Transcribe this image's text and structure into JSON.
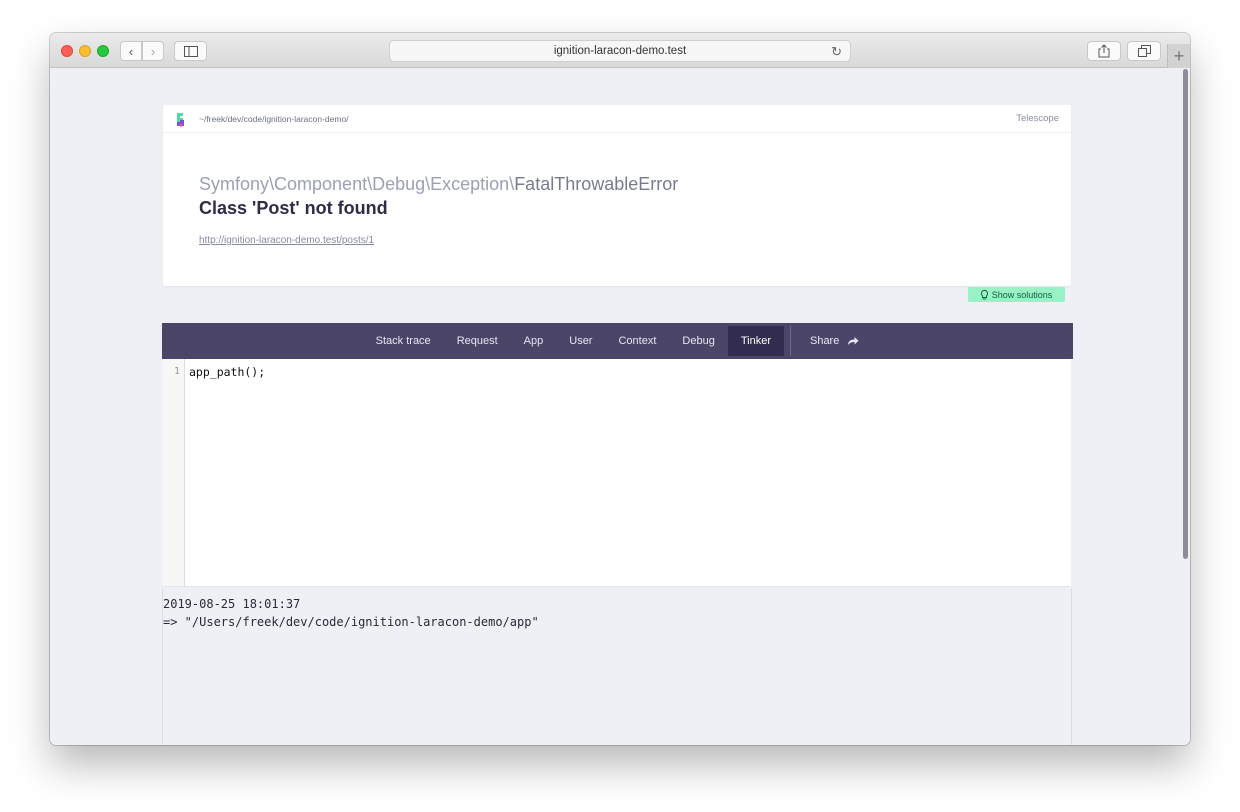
{
  "browser": {
    "url": "ignition-laracon-demo.test"
  },
  "header": {
    "path": "~/freek/dev/code/ignition-laracon-demo/",
    "telescope_link": "Telescope",
    "exception_namespace": "Symfony\\Component\\Debug\\Exception\\",
    "exception_class": "FatalThrowableError",
    "message": "Class 'Post' not found",
    "url": "http://ignition-laracon-demo.test/posts/1"
  },
  "solutions_button": "Show solutions",
  "tabs": [
    {
      "label": "Stack trace",
      "active": false
    },
    {
      "label": "Request",
      "active": false
    },
    {
      "label": "App",
      "active": false
    },
    {
      "label": "User",
      "active": false
    },
    {
      "label": "Context",
      "active": false
    },
    {
      "label": "Debug",
      "active": false
    },
    {
      "label": "Tinker",
      "active": true
    }
  ],
  "share_tab": "Share",
  "editor": {
    "line_number": "1",
    "code": "app_path();"
  },
  "output": {
    "timestamp": "2019-08-25 18:01:37",
    "result": "=> \"/Users/freek/dev/code/ignition-laracon-demo/app\""
  },
  "colors": {
    "tabbar": "#4b4668",
    "tab_active": "#322d4e",
    "solutions": "#98f2c3"
  }
}
